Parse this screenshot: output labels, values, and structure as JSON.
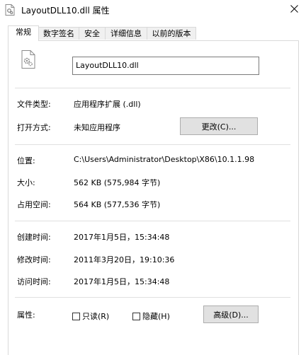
{
  "window": {
    "title": "LayoutDLL10.dll 属性"
  },
  "tabs": [
    {
      "label": "常规"
    },
    {
      "label": "数字签名"
    },
    {
      "label": "安全"
    },
    {
      "label": "详细信息"
    },
    {
      "label": "以前的版本"
    }
  ],
  "general": {
    "file_name": "LayoutDLL10.dll",
    "type_label": "文件类型:",
    "type_value": "应用程序扩展 (.dll)",
    "opens_label": "打开方式:",
    "opens_value": "未知应用程序",
    "change_button": "更改(C)...",
    "location_label": "位置:",
    "location_value": "C:\\Users\\Administrator\\Desktop\\X86\\10.1.1.98",
    "size_label": "大小:",
    "size_value": "562 KB (575,984 字节)",
    "disk_label": "占用空间:",
    "disk_value": "564 KB (577,536 字节)",
    "created_label": "创建时间:",
    "created_value": "2017年1月5日，15:34:48",
    "modified_label": "修改时间:",
    "modified_value": "2011年3月20日，19:10:36",
    "accessed_label": "访问时间:",
    "accessed_value": "2017年1月5日，15:34:48",
    "attributes_label": "属性:",
    "readonly_label": "只读(R)",
    "readonly_checked": false,
    "hidden_label": "隐藏(H)",
    "hidden_checked": false,
    "advanced_button": "高级(D)..."
  },
  "icons": {
    "title": "dll-file-icon",
    "file": "gear-file-icon",
    "close": "close-icon"
  }
}
